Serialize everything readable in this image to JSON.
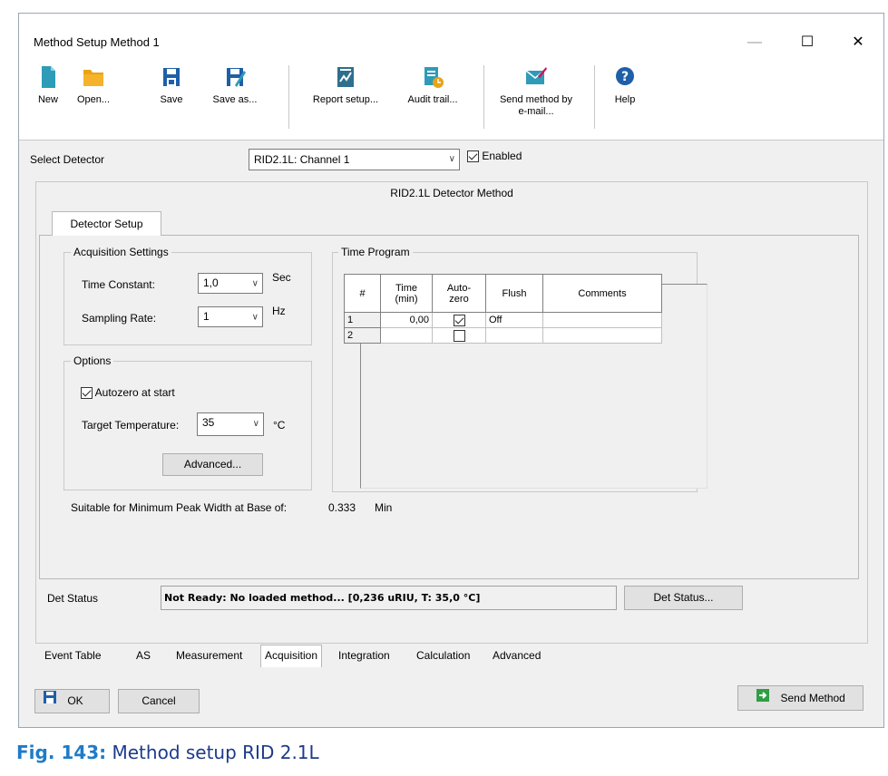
{
  "window": {
    "title": "Method Setup Method 1",
    "controls": {
      "minimize": "—",
      "maximize": "☐",
      "close": "✕"
    }
  },
  "toolbar": {
    "new": "New",
    "open": "Open...",
    "save": "Save",
    "save_as": "Save as...",
    "report_setup": "Report setup...",
    "audit_trail": "Audit trail...",
    "send_email_line1": "Send method by",
    "send_email_line2": "e-mail...",
    "help": "Help"
  },
  "detector": {
    "label": "Select Detector",
    "selected": "RID2.1L: Channel 1",
    "enabled_label": "Enabled",
    "enabled": true
  },
  "method_title": "RID2.1L Detector Method",
  "detector_tab": "Detector Setup",
  "acquisition": {
    "group_title": "Acquisition Settings",
    "time_constant_label": "Time Constant:",
    "time_constant_value": "1,0",
    "time_constant_unit": "Sec",
    "sampling_rate_label": "Sampling Rate:",
    "sampling_rate_value": "1",
    "sampling_rate_unit": "Hz"
  },
  "options": {
    "group_title": "Options",
    "autozero_label": "Autozero at start",
    "autozero": true,
    "target_temp_label": "Target Temperature:",
    "target_temp_value": "35",
    "target_temp_unit": "°C",
    "advanced_button": "Advanced..."
  },
  "time_program": {
    "group_title": "Time Program",
    "headers": [
      "#",
      "Time\n(min)",
      "Auto-\nzero",
      "Flush",
      "Comments"
    ],
    "rows": [
      {
        "num": "1",
        "time": "0,00",
        "autozero": true,
        "flush": "Off",
        "comments": ""
      },
      {
        "num": "2",
        "time": "",
        "autozero": false,
        "flush": "",
        "comments": ""
      }
    ]
  },
  "peak_width": {
    "label": "Suitable for Minimum Peak Width at Base of:",
    "value": "0.333",
    "unit": "Min"
  },
  "status": {
    "label": "Det Status",
    "text": "Not Ready: No loaded method... [0,236 uRIU, T: 35,0 °C]",
    "button": "Det Status..."
  },
  "bottom_tabs": [
    "Event Table",
    "AS",
    "Measurement",
    "Acquisition",
    "Integration",
    "Calculation",
    "Advanced"
  ],
  "active_bottom_tab": "Acquisition",
  "footer": {
    "ok": "OK",
    "cancel": "Cancel",
    "send_method": "Send Method"
  },
  "caption": {
    "fig": "Fig. 143:",
    "text": "Method setup RID 2.1L"
  },
  "colors": {
    "caption_fig": "#1e7bc8",
    "caption_text": "#1d3a8a",
    "icon_blue": "#1f5fa8",
    "icon_teal": "#2e9bb8",
    "icon_orange": "#e8a317",
    "send_green": "#2f9e44"
  }
}
